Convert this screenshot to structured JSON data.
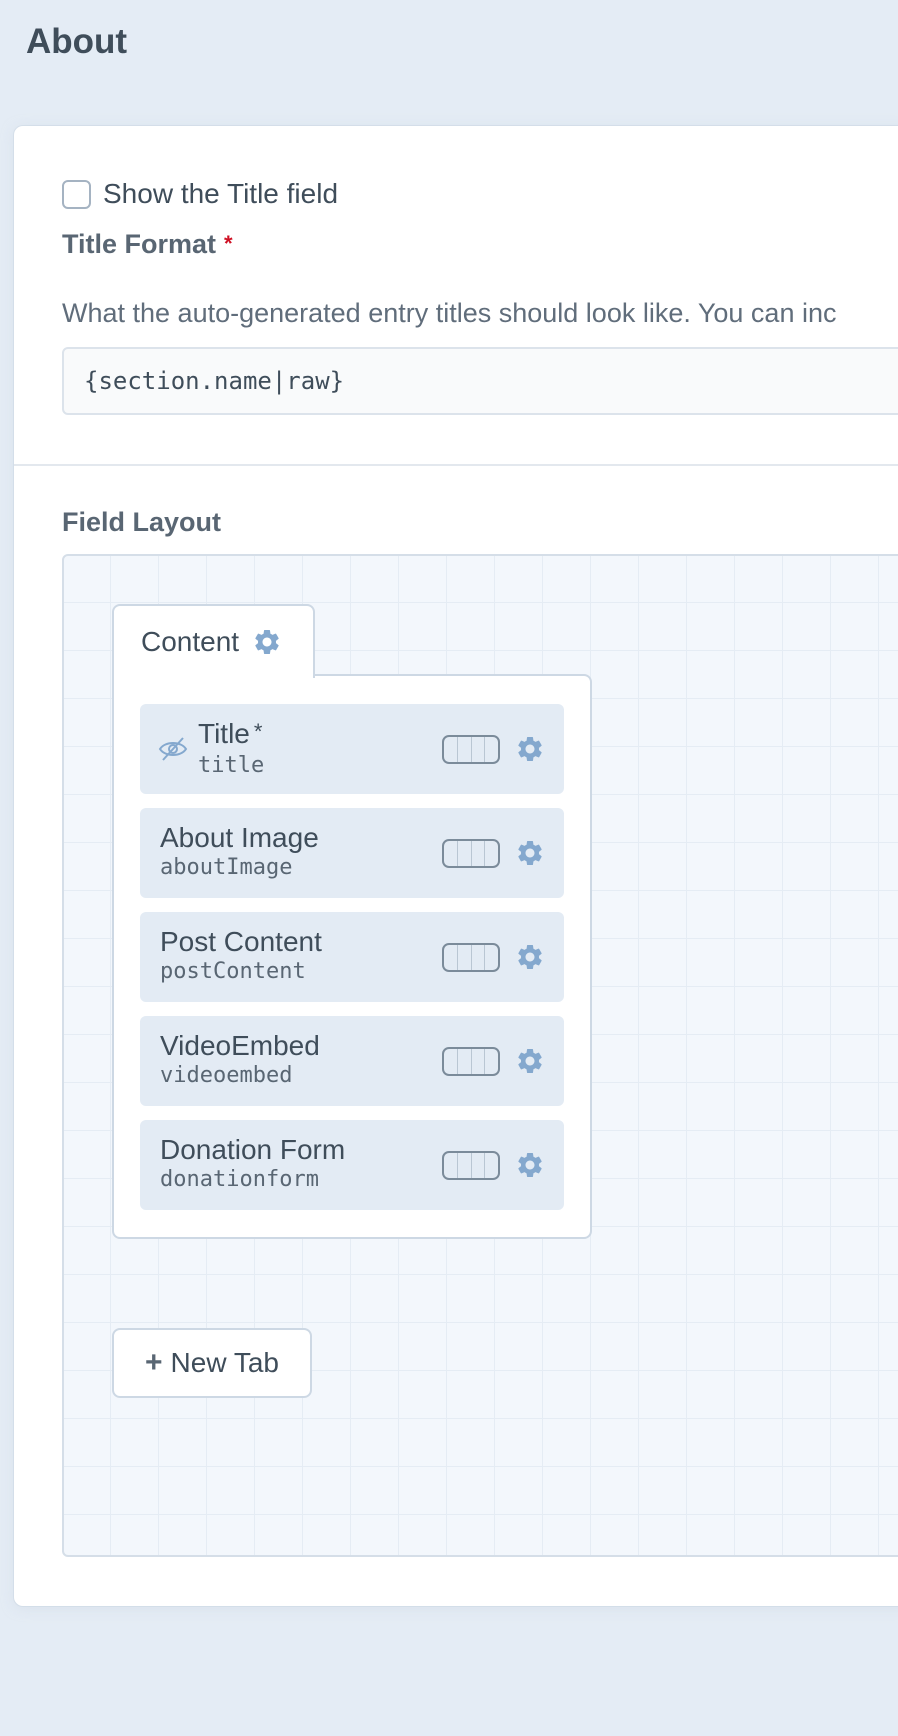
{
  "page": {
    "title": "About"
  },
  "show_title_field": {
    "label": "Show the Title field",
    "checked": false
  },
  "title_format": {
    "label": "Title Format",
    "required_marker": "*",
    "instructions": "What the auto-generated entry titles should look like. You can inc",
    "value": "{section.name|raw}"
  },
  "field_layout": {
    "heading": "Field Layout",
    "tab": {
      "name": "Content",
      "icon": "gear-icon"
    },
    "elements": [
      {
        "name": "Title",
        "handle": "title",
        "required": "*",
        "hidden": true
      },
      {
        "name": "About Image",
        "handle": "aboutImage"
      },
      {
        "name": "Post Content",
        "handle": "postContent"
      },
      {
        "name": "VideoEmbed",
        "handle": "videoembed"
      },
      {
        "name": "Donation Form",
        "handle": "donationform"
      }
    ],
    "new_tab": {
      "label": "New Tab",
      "icon": "plus-icon"
    }
  },
  "colors": {
    "background": "#e4ecf5",
    "card": "#ffffff",
    "field_element": "#e3ebf4",
    "icon_accent": "#84a8ce",
    "required": "#cf1124"
  }
}
